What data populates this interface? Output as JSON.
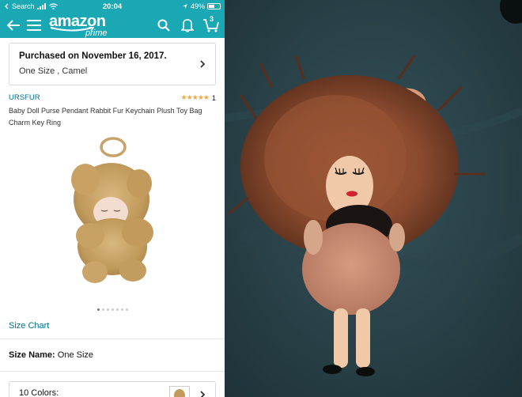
{
  "status_bar": {
    "back_app": "Search",
    "time": "20:04",
    "battery": "49%"
  },
  "header": {
    "logo": "amazon",
    "logo_sub": "prime",
    "cart_count": "3"
  },
  "purchase": {
    "title": "Purchased on November 16, 2017.",
    "detail": "One Size , Camel"
  },
  "product": {
    "brand": "URSFUR",
    "stars": "★★★★★",
    "rating_count": "1",
    "title": "Baby Doll Purse Pendant Rabbit Fur Keychain Plush Toy Bag Charm Key Ring",
    "image_count": 7,
    "active_image": 1
  },
  "size_chart": "Size Chart",
  "size": {
    "label": "Size Name:",
    "value": "One Size"
  },
  "colors": {
    "label": "10 Colors:"
  },
  "colors_meta": {
    "accent": "#1aa8b5",
    "link": "#007185",
    "star": "#f3a847"
  }
}
